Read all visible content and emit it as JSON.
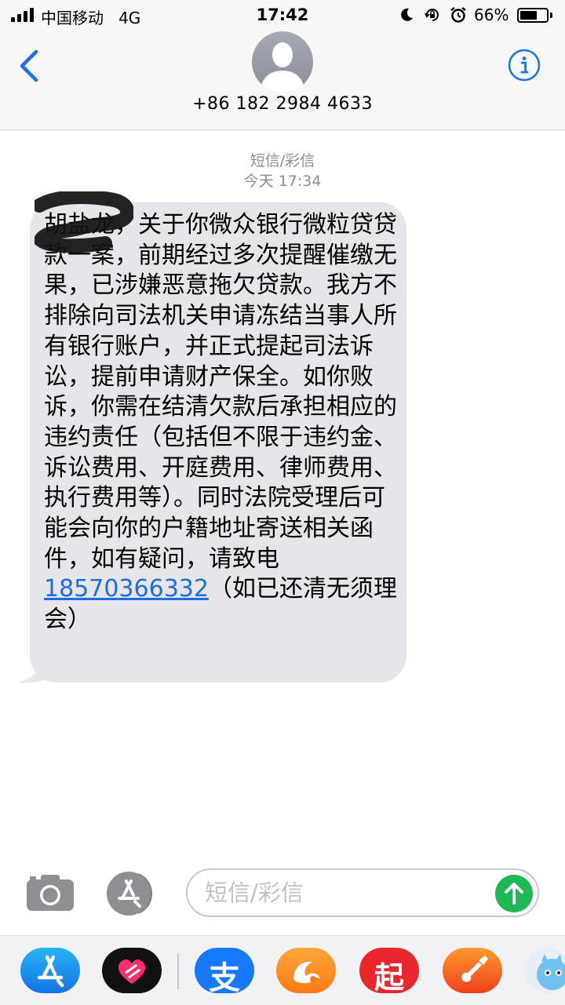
{
  "status_bar": {
    "carrier": "中国移动",
    "network": "4G",
    "time": "17:42",
    "battery_percent": "66%",
    "battery_level": 0.66,
    "icons": [
      "signal-icon",
      "moon-icon",
      "rotation-lock-icon",
      "alarm-icon",
      "battery-icon"
    ]
  },
  "header": {
    "contact_number": "+86 182 2984 4633",
    "back_icon": "chevron-left-icon",
    "info_icon": "info-icon",
    "accent_color": "#1a73e8"
  },
  "conversation": {
    "message_type": "短信/彩信",
    "timestamp": "今天 17:34",
    "message": {
      "sender_name": "胡盐龙",
      "body_before_link": "，关于你微众银行微粒贷贷款一案，前期经过多次提醒催缴无果，已涉嫌恶意拖欠贷款。我方不排除向司法机关申请冻结当事人所有银行账户，并正式提起司法诉讼，提前申请财产保全。如你败诉，你需在结清欠款后承担相应的违约责任（包括但不限于违约金、诉讼费用、开庭费用、律师费用、执行费用等）。同时法院受理后可能会向你的户籍地址寄送相关函件，如有疑问，请致电",
      "phone_link": "18570366332",
      "body_after_link": "（如已还清无须理会）",
      "bubble_color": "#e5e5ea"
    }
  },
  "composer": {
    "placeholder": "短信/彩信",
    "send_color": "#1db954"
  },
  "app_drawer": {
    "apps": [
      "app-store-icon",
      "heart-app-icon",
      "alipay-icon",
      "uc-browser-icon",
      "qidian-icon",
      "garageband-icon",
      "monster-app-icon"
    ],
    "labels": {
      "alipay": "支",
      "qidian": "起"
    }
  }
}
